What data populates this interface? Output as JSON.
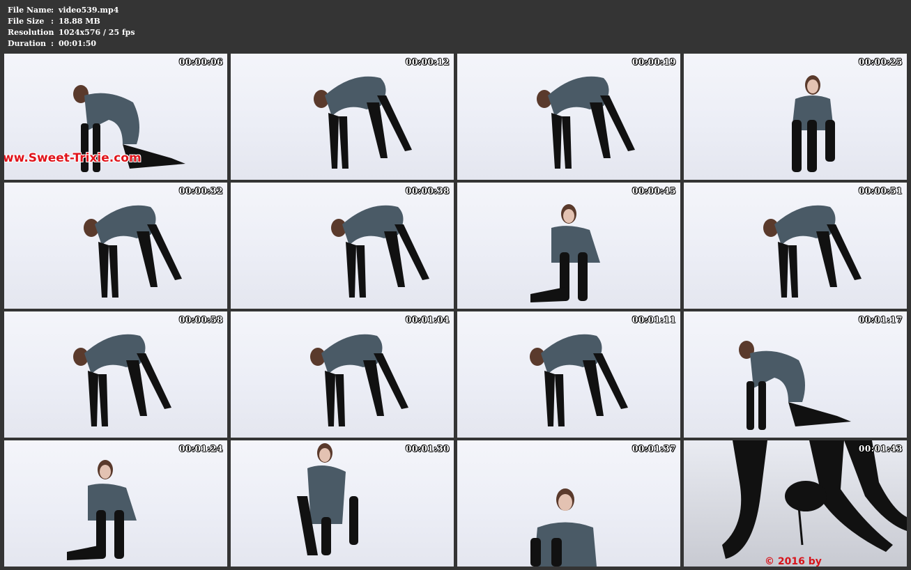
{
  "info": {
    "file_name_label": "File Name",
    "file_name": "video539.mp4",
    "file_size_label": "File Size",
    "file_size": "18.88 MB",
    "resolution_label": "Resolution",
    "resolution": "1024x576 / 25 fps",
    "duration_label": "Duration",
    "duration": "00:01:50",
    "separator": ":"
  },
  "thumbnails": [
    {
      "timestamp": "00:00:06"
    },
    {
      "timestamp": "00:00:12"
    },
    {
      "timestamp": "00:00:19"
    },
    {
      "timestamp": "00:00:25"
    },
    {
      "timestamp": "00:00:32"
    },
    {
      "timestamp": "00:00:38"
    },
    {
      "timestamp": "00:00:45"
    },
    {
      "timestamp": "00:00:51"
    },
    {
      "timestamp": "00:00:58"
    },
    {
      "timestamp": "00:01:04"
    },
    {
      "timestamp": "00:01:11"
    },
    {
      "timestamp": "00:01:17"
    },
    {
      "timestamp": "00:01:24"
    },
    {
      "timestamp": "00:01:30"
    },
    {
      "timestamp": "00:01:37"
    },
    {
      "timestamp": "00:01:43"
    }
  ],
  "watermark_text": "ww.Sweet-Trixie.com",
  "copyright_text": "© 2016 by",
  "colors": {
    "background": "#343434",
    "backdrop": "#eceef6",
    "suit": "#4a5a66",
    "boots": "#111111",
    "watermark": "#e0141b"
  }
}
